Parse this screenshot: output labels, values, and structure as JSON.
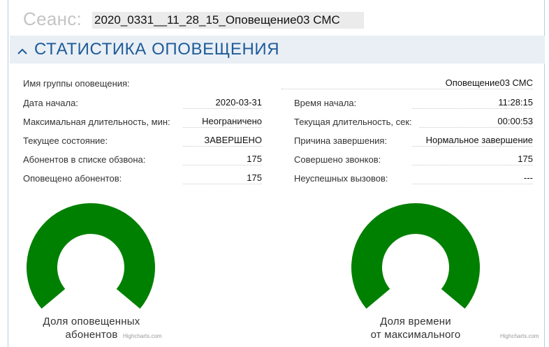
{
  "session": {
    "label": "Сеанс:",
    "value": "2020_0331__11_28_15_Оповещение03 СМС"
  },
  "section": {
    "chevron_icon": "chevron-up-icon",
    "title": "СТАТИСТИКА ОПОВЕЩЕНИЯ"
  },
  "group": {
    "label": "Имя группы оповещения:",
    "value": "Оповещение03 СМС"
  },
  "left_stats": [
    {
      "label": "Дата начала:",
      "value": "2020-03-31"
    },
    {
      "label": "Максимальная длительность, мин:",
      "value": "Неограничено"
    },
    {
      "label": "Текущее состояние:",
      "value": "ЗАВЕРШЕНО"
    },
    {
      "label": "Абонентов в списке обзвона:",
      "value": "175"
    },
    {
      "label": "Оповещено абонентов:",
      "value": "175"
    }
  ],
  "right_stats": [
    {
      "label": "Время начала:",
      "value": "11:28:15"
    },
    {
      "label": "Текущая длительность, сек:",
      "value": "00:00:53"
    },
    {
      "label": "Причина завершения:",
      "value": "Нормальное завершение"
    },
    {
      "label": "Совершено звонков:",
      "value": "175"
    },
    {
      "label": "Неуспешных вызовов:",
      "value": "---"
    }
  ],
  "gauges": [
    {
      "title_line1": "Доля оповещенных",
      "title_line2": "абонентов",
      "fraction": 1.0,
      "color": "#008000"
    },
    {
      "title_line1": "Доля времени",
      "title_line2": "от максимального",
      "fraction": 1.0,
      "color": "#008000"
    }
  ],
  "credits": [
    "Highcharts.com",
    "Highcharts.com"
  ],
  "colors": {
    "accent": "#1f5b98",
    "header_bg": "#e9eff5",
    "gauge": "#008000"
  }
}
